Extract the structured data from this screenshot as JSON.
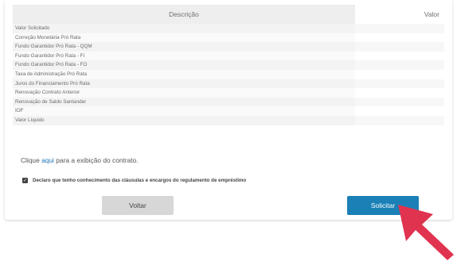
{
  "table": {
    "header_description": "Descrição",
    "header_value": "Valor",
    "rows": [
      {
        "label": "Valor Solicitado",
        "value": ""
      },
      {
        "label": "Correção Monetária Pró Rata",
        "value": ""
      },
      {
        "label": "Fundo Garantidor Pró Rata - QQM",
        "value": ""
      },
      {
        "label": "Fundo Garantidor Pró Rata - FI",
        "value": ""
      },
      {
        "label": "Fundo Garantidor Pró Rata - FO",
        "value": ""
      },
      {
        "label": "Taxa de Administração Pró Rata",
        "value": ""
      },
      {
        "label": "Juros do Financiamento Pró Rata",
        "value": ""
      },
      {
        "label": "Renovação Contrato Anterior",
        "value": ""
      },
      {
        "label": "Renovação de Saldo Santander",
        "value": ""
      },
      {
        "label": "IOF",
        "value": ""
      },
      {
        "label": "Valor Líquido",
        "value": ""
      }
    ]
  },
  "contract": {
    "prefix": "Clique ",
    "link": "aqui",
    "suffix": " para a exibição do contrato."
  },
  "agreement": {
    "checked": true,
    "check_glyph": "✓",
    "label": "Declaro que tenho conhecimento das cláusulas e encargos do regulamento de empréstimo"
  },
  "buttons": {
    "back": "Voltar",
    "submit": "Solicitar"
  },
  "colors": {
    "primary": "#1a80b6",
    "link": "#1a74b8",
    "pointer": "#e0334f"
  },
  "icons": {
    "pointer": "arrow-pointer-icon"
  }
}
